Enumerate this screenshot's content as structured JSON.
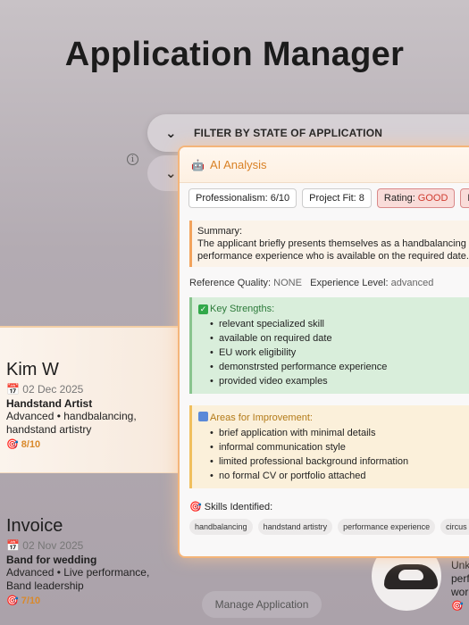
{
  "page_title": "Application Manager",
  "filter": {
    "label": "FILTER BY STATE OF APPLICATION"
  },
  "applications": [
    {
      "name": "Kim W",
      "date": "02 Dec 2025",
      "role": "Handstand Artist",
      "desc_line1": "Advanced • handbalancing,",
      "desc_line2": "handstand artistry",
      "score": "8/10"
    },
    {
      "name": "Invoice",
      "date": "02 Nov 2025",
      "role": "Band for wedding",
      "desc_line1": "Advanced • Live performance,",
      "desc_line2": "Band leadership",
      "score": "7/10"
    }
  ],
  "manage_button": "Manage Application",
  "right_card": {
    "line1": "Unk",
    "line2": "perf",
    "line3": "wor",
    "score": ""
  },
  "ai": {
    "title": "AI Analysis",
    "professionalism": "Professionalism: 6/10",
    "project_fit": "Project Fit: 8",
    "rating_label": "Rating:",
    "rating_value": "GOOD",
    "extra_badge": "Rec",
    "summary_label": "Summary:",
    "summary_line1": "The applicant briefly presents themselves as a handbalancing artis",
    "summary_line2": "performance experience who is available on the required date.",
    "reference_label": "Reference Quality:",
    "reference_value": "NONE",
    "experience_label": "Experience Level:",
    "experience_value": "advanced",
    "strengths_title": "Key Strengths:",
    "strengths": [
      "relevant specialized skill",
      "available on required date",
      "EU work eligibility",
      "demonstrsted performance experience",
      "provided video examples"
    ],
    "improve_title": "Areas for Improvement:",
    "improvements": [
      "brief application with minimal details",
      "informal communication style",
      "limited professional background information",
      "no formal CV or portfolio attached"
    ],
    "skills_title": "Skills Identified:",
    "skills": [
      "handbalancing",
      "handstand artistry",
      "performance experience",
      "circus arts"
    ]
  },
  "colors": {
    "accent": "#f4b57a",
    "score": "#d9892b",
    "rating_red": "#cf3b2f"
  }
}
